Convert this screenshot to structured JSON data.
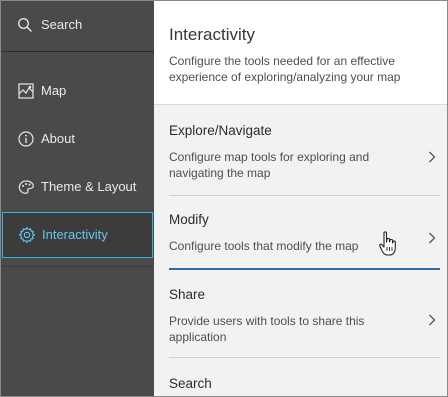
{
  "sidebar": {
    "search_label": "Search",
    "items": [
      {
        "label": "Map",
        "icon": "map-icon"
      },
      {
        "label": "About",
        "icon": "info-icon"
      },
      {
        "label": "Theme & Layout",
        "icon": "palette-icon"
      },
      {
        "label": "Interactivity",
        "icon": "gear-icon",
        "active": true
      }
    ]
  },
  "panel": {
    "title": "Interactivity",
    "description": "Configure the tools needed for an effective experience of exploring/analyzing your map",
    "sections": [
      {
        "title": "Explore/Navigate",
        "description": "Configure map tools for exploring and navigating the map"
      },
      {
        "title": "Modify",
        "description": "Configure tools that modify the map"
      },
      {
        "title": "Share",
        "description": "Provide users with tools to share this application"
      },
      {
        "title": "Search",
        "description": ""
      }
    ]
  },
  "colors": {
    "sidebar_bg": "#4a4a4a",
    "active_accent": "#2fb2e6",
    "panel_bg": "#f2f2f2",
    "divider_active": "#2c6ea6"
  }
}
